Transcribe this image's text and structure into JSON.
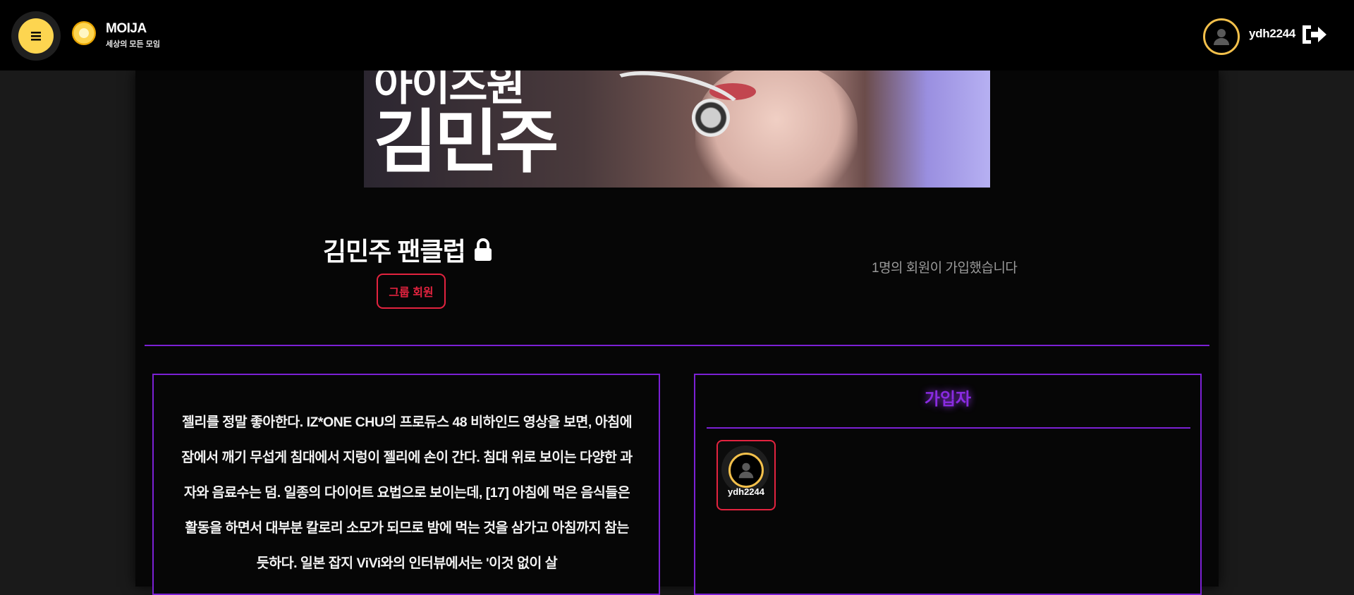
{
  "header": {
    "menu_icon": "hamburger-menu-icon",
    "brand": {
      "name": "MOIJA",
      "tagline": "세상의 모든 모임"
    },
    "user": {
      "username": "ydh2244",
      "avatar_icon": "user-avatar-icon",
      "logout_icon": "logout-icon"
    }
  },
  "banner": {
    "text_line1": "아이즈원",
    "text_line2": "김민주"
  },
  "group": {
    "title": "김민주 팬클럽",
    "lock_icon": "lock-icon",
    "member_badge": "그룹 회원",
    "member_count_text": "1명의 회원이 가입했습니다"
  },
  "description": {
    "text": "젤리를 정말 좋아한다. IZ*ONE CHU의 프로듀스 48 비하인드 영상을 보면, 아침에 잠에서 깨기 무섭게 침대에서 지렁이 젤리에 손이 간다. 침대 위로 보이는 다양한 과자와 음료수는 덤. 일종의 다이어트 요법으로 보이는데, [17] 아침에 먹은 음식들은 활동을 하면서 대부분 칼로리 소모가 되므로 밤에 먹는 것을 삼가고 아침까지 참는 듯하다. 일본 잡지 ViVi와의 인터뷰에서는 '이것 없이 살"
  },
  "members": {
    "title": "가입자",
    "list": [
      {
        "username": "ydh2244"
      }
    ]
  },
  "colors": {
    "accent_yellow": "#fdd550",
    "accent_purple": "#7b20d4",
    "accent_red": "#e3233f",
    "background": "#060606"
  }
}
